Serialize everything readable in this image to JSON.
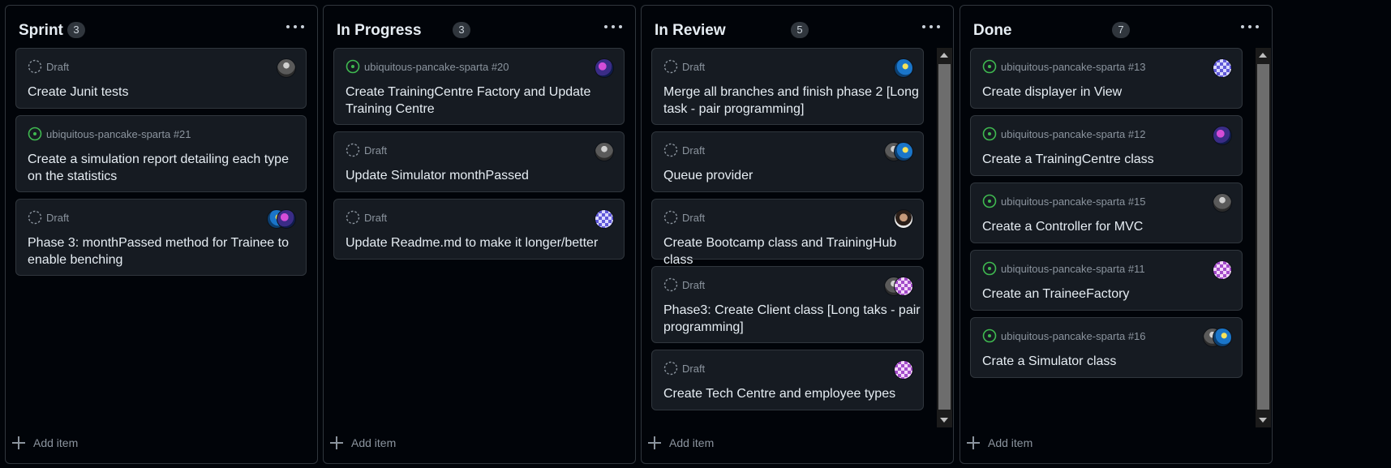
{
  "add_item_label": "Add item",
  "colors": {
    "open": "#3fb950",
    "draft": "#8b949e",
    "background": "#010409",
    "card": "#161b22"
  },
  "columns": [
    {
      "name": "Sprint",
      "count": "3",
      "cards": [
        {
          "status": "draft",
          "meta": "Draft",
          "title_lines": [
            "Create Junit tests"
          ],
          "avatars": [
            "grey"
          ]
        },
        {
          "status": "open",
          "meta": "ubiquitous-pancake-sparta #21",
          "title_lines": [
            "Create a simulation report detailing each type",
            "on the statistics"
          ],
          "avatars": []
        },
        {
          "status": "draft",
          "meta": "Draft",
          "title_lines": [
            "Phase 3: monthPassed method for Trainee to",
            "enable benching"
          ],
          "avatars": [
            "blue",
            "purple"
          ]
        }
      ]
    },
    {
      "name": "In Progress",
      "count": "3",
      "cards": [
        {
          "status": "open",
          "meta": "ubiquitous-pancake-sparta #20",
          "title_lines": [
            "Create TrainingCentre Factory and Update",
            "Training Centre"
          ],
          "avatars": [
            "purple"
          ]
        },
        {
          "status": "draft",
          "meta": "Draft",
          "title_lines": [
            "Update Simulator monthPassed"
          ],
          "avatars": [
            "grey"
          ]
        },
        {
          "status": "draft",
          "meta": "Draft",
          "title_lines": [
            "Update Readme.md to make it longer/better"
          ],
          "avatars": [
            "check"
          ]
        }
      ]
    },
    {
      "name": "In Review",
      "count": "5",
      "cards": [
        {
          "status": "draft",
          "meta": "Draft",
          "title_lines": [
            "Merge all branches and finish phase 2 [Long",
            "task - pair programming]"
          ],
          "avatars": [
            "blue"
          ]
        },
        {
          "status": "draft",
          "meta": "Draft",
          "title_lines": [
            "Queue provider"
          ],
          "avatars": [
            "grey",
            "blue"
          ]
        },
        {
          "status": "draft",
          "meta": "Draft",
          "title_lines": [
            "Create Bootcamp class and TrainingHub class"
          ],
          "avatars": [
            "man"
          ]
        },
        {
          "status": "draft",
          "meta": "Draft",
          "title_lines": [
            "Phase3: Create Client class [Long taks - pair",
            "programming]"
          ],
          "avatars": [
            "grey",
            "pink"
          ]
        },
        {
          "status": "draft",
          "meta": "Draft",
          "title_lines": [
            "Create Tech Centre and employee types"
          ],
          "avatars": [
            "pink"
          ]
        }
      ]
    },
    {
      "name": "Done",
      "count": "7",
      "cards": [
        {
          "status": "open",
          "meta": "ubiquitous-pancake-sparta #13",
          "title_lines": [
            "Create displayer in View"
          ],
          "avatars": [
            "check"
          ]
        },
        {
          "status": "open",
          "meta": "ubiquitous-pancake-sparta #12",
          "title_lines": [
            "Create a TrainingCentre class"
          ],
          "avatars": [
            "purple"
          ]
        },
        {
          "status": "open",
          "meta": "ubiquitous-pancake-sparta #15",
          "title_lines": [
            "Create a Controller for MVC"
          ],
          "avatars": [
            "grey"
          ]
        },
        {
          "status": "open",
          "meta": "ubiquitous-pancake-sparta #11",
          "title_lines": [
            "Create an TraineeFactory"
          ],
          "avatars": [
            "pink"
          ]
        },
        {
          "status": "open",
          "meta": "ubiquitous-pancake-sparta #16",
          "title_lines": [
            "Crate a Simulator class"
          ],
          "avatars": [
            "grey",
            "blue"
          ]
        }
      ]
    }
  ]
}
